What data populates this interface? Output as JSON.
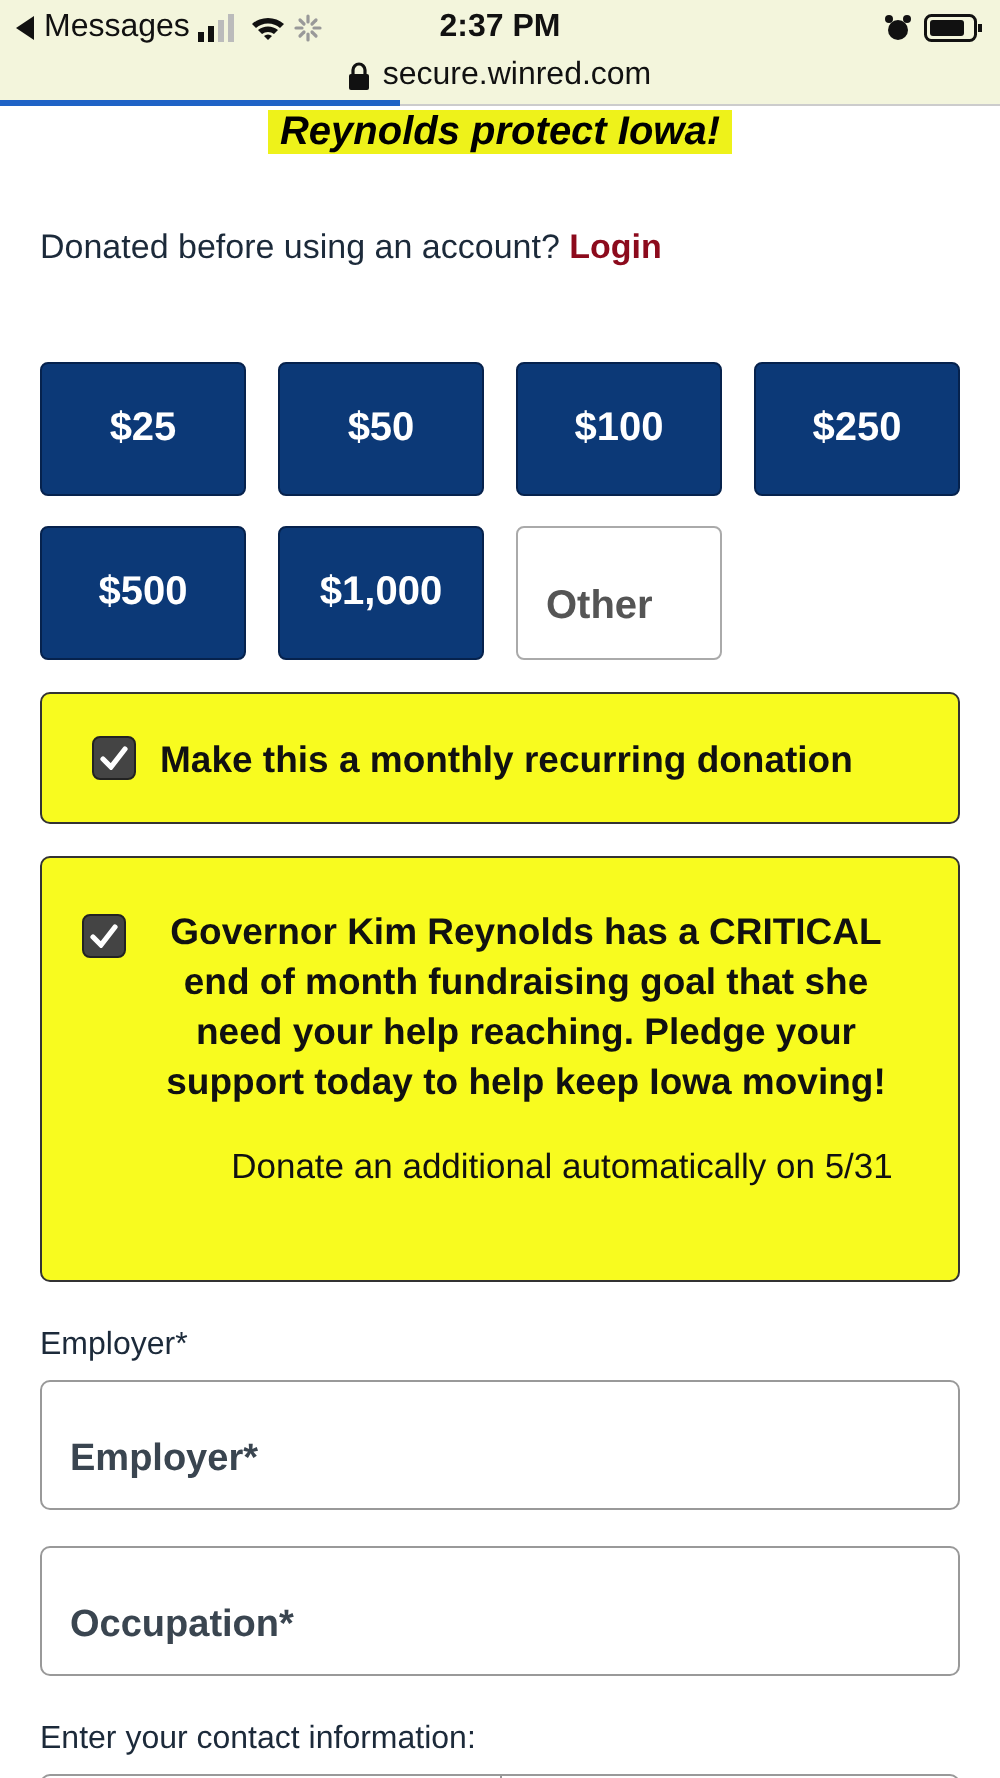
{
  "status_bar": {
    "back_label": "Messages",
    "time": "2:37 PM",
    "url": "secure.winred.com",
    "page_load": {
      "level": 0.4
    }
  },
  "headline": "Reynolds protect Iowa!",
  "login_prompt": {
    "text": "Donated before using an account?",
    "link": "Login"
  },
  "amounts": [
    {
      "kind": "amount",
      "label": "$25"
    },
    {
      "kind": "amount",
      "label": "$50"
    },
    {
      "kind": "amount",
      "label": "$100"
    },
    {
      "kind": "amount",
      "label": "$250"
    },
    {
      "kind": "amount",
      "label": "$500"
    },
    {
      "kind": "amount",
      "label": "$1,000"
    },
    {
      "kind": "other",
      "placeholder": "Other"
    }
  ],
  "options": [
    {
      "checked": true,
      "text": "Make this a monthly recurring donation"
    },
    {
      "checked": true,
      "text": "Governor Kim Reynolds has a CRITICAL end of month fundraising goal that she need your help reaching. Pledge your support today to help keep Iowa moving!",
      "note": "Donate an additional automatically on 5/31"
    }
  ],
  "employment": {
    "label": "Employer*",
    "fields": [
      {
        "placeholder": "Employer*"
      },
      {
        "placeholder": "Occupation*"
      }
    ]
  },
  "contact": {
    "label": "Enter your contact information:"
  }
}
